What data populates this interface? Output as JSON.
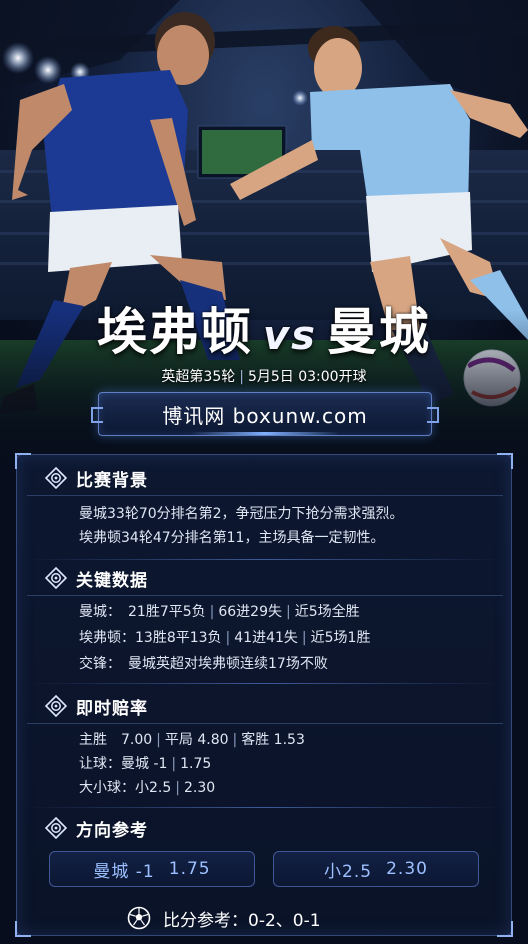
{
  "hero": {
    "team_home": "埃弗顿",
    "vs": "vs",
    "team_away": "曼城",
    "league_round": "英超第35轮",
    "kickoff": "5月5日 03:00开球",
    "site": "博讯网 boxunw.com"
  },
  "sections": {
    "background": {
      "title": "比赛背景",
      "icon": "target-diamond-icon",
      "lines": [
        "曼城33轮70分排名第2，争冠压力下抢分需求强烈。",
        "埃弗顿34轮47分排名第11，主场具备一定韧性。"
      ]
    },
    "key_data": {
      "title": "关键数据",
      "icon": "target-diamond-icon",
      "city": {
        "label": "曼城：",
        "record": "21胜7平5负",
        "goals": "66进29失",
        "recent": "近5场全胜"
      },
      "everton": {
        "label": "埃弗顿：",
        "record": "13胜8平13负",
        "goals": "41进41失",
        "recent": "近5场1胜"
      },
      "h2h": {
        "label": "交锋：",
        "text": "曼城英超对埃弗顿连续17场不败"
      }
    },
    "odds": {
      "title": "即时赔率",
      "icon": "target-diamond-icon",
      "home_win": "主胜　7.00",
      "draw": "平局 4.80",
      "away_win": "客胜 1.53",
      "handicap_label": "让球：曼城 -1",
      "handicap_value": "1.75",
      "total_label": "大小球：小2.5",
      "total_value": "2.30"
    },
    "direction": {
      "title": "方向参考",
      "icon": "target-diamond-icon",
      "pick1_label": "曼城 -1",
      "pick1_odds": "1.75",
      "pick2_label": "小2.5",
      "pick2_odds": "2.30"
    }
  },
  "score_ref": {
    "icon": "soccer-ball-icon",
    "text": "比分参考：0-2、0-1"
  },
  "colors": {
    "background": "#070d1c",
    "panel": "#0d1730",
    "accent_blue": "#9cc0ff",
    "everton_blue": "#1c3a94",
    "city_sky_blue": "#8fc0ea"
  }
}
